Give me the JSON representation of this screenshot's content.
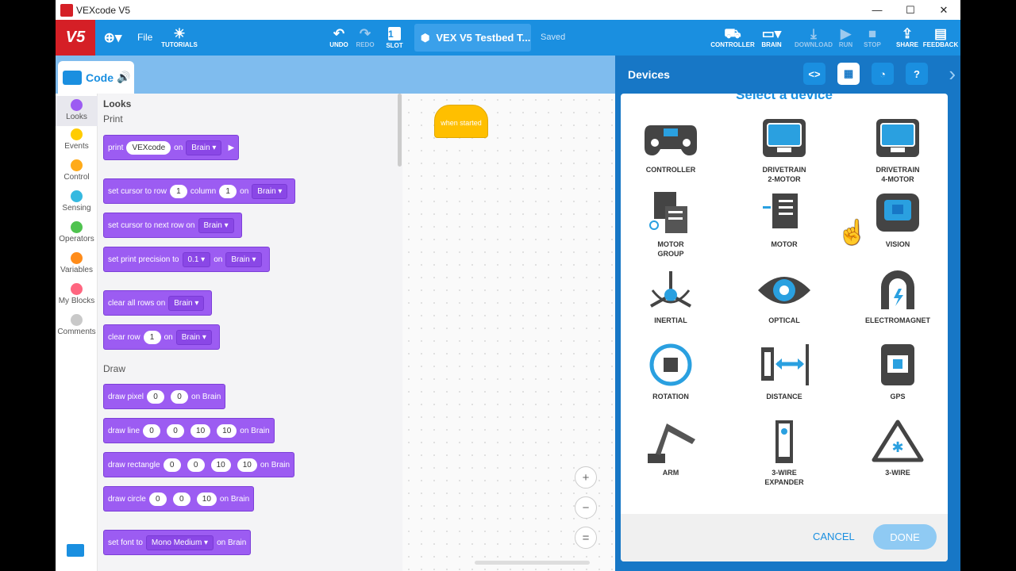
{
  "window": {
    "title": "VEXcode V5",
    "min": "—",
    "max": "☐",
    "close": "✕"
  },
  "topbar": {
    "logo": "V5",
    "file": "File",
    "tutorials": "TUTORIALS",
    "undo": "UNDO",
    "redo": "REDO",
    "slot": "SLOT",
    "slot_num": "1",
    "project_name": "VEX V5 Testbed T...",
    "status": "Saved",
    "controller": "CONTROLLER",
    "brain": "BRAIN",
    "download": "DOWNLOAD",
    "run": "RUN",
    "stop": "STOP",
    "share": "SHARE",
    "feedback": "FEEDBACK"
  },
  "codetab": {
    "label": "Code"
  },
  "categories": [
    {
      "label": "Looks",
      "color": "#9c5cf2"
    },
    {
      "label": "Events",
      "color": "#ffcc00"
    },
    {
      "label": "Control",
      "color": "#ffab19"
    },
    {
      "label": "Sensing",
      "color": "#36b9e0"
    },
    {
      "label": "Operators",
      "color": "#4fc34f"
    },
    {
      "label": "Variables",
      "color": "#ff8c1a"
    },
    {
      "label": "My Blocks",
      "color": "#ff6680"
    },
    {
      "label": "Comments",
      "color": "#c9c9c9"
    }
  ],
  "palette": {
    "section": "Looks",
    "print_heading": "Print",
    "draw_heading": "Draw",
    "print": {
      "a": "print",
      "val": "VEXcode",
      "on": "on",
      "dev": "Brain",
      "play": "▶"
    },
    "set_cursor": {
      "a": "set cursor to row",
      "row": "1",
      "col_lbl": "column",
      "col": "1",
      "on": "on",
      "dev": "Brain"
    },
    "next_row": {
      "a": "set cursor to next row on",
      "dev": "Brain"
    },
    "precision": {
      "a": "set print precision to",
      "val": "0.1",
      "on": "on",
      "dev": "Brain"
    },
    "clear_all": {
      "a": "clear all rows on",
      "dev": "Brain"
    },
    "clear_row": {
      "a": "clear row",
      "val": "1",
      "on": "on",
      "dev": "Brain"
    },
    "pixel": {
      "a": "draw pixel",
      "x": "0",
      "y": "0",
      "on": "on Brain"
    },
    "line": {
      "a": "draw line",
      "v1": "0",
      "v2": "0",
      "v3": "10",
      "v4": "10",
      "on": "on Brain"
    },
    "rect": {
      "a": "draw rectangle",
      "v1": "0",
      "v2": "0",
      "v3": "10",
      "v4": "10",
      "on": "on Brain"
    },
    "circle": {
      "a": "draw circle",
      "v1": "0",
      "v2": "0",
      "v3": "10",
      "on": "on Brain"
    },
    "font": {
      "a": "set font to",
      "val": "Mono Medium",
      "on": "on Brain"
    }
  },
  "workspace": {
    "hat": "when started",
    "zoom_in": "+",
    "zoom_out": "−",
    "reset": "="
  },
  "devices_panel": {
    "title": "Devices",
    "dialog_title": "Select a device",
    "cancel": "CANCEL",
    "done": "DONE",
    "devices": [
      {
        "name": "CONTROLLER",
        "sub": ""
      },
      {
        "name": "DRIVETRAIN",
        "sub": "2-MOTOR"
      },
      {
        "name": "DRIVETRAIN",
        "sub": "4-MOTOR"
      },
      {
        "name": "MOTOR",
        "sub": "GROUP"
      },
      {
        "name": "MOTOR",
        "sub": ""
      },
      {
        "name": "VISION",
        "sub": ""
      },
      {
        "name": "INERTIAL",
        "sub": ""
      },
      {
        "name": "OPTICAL",
        "sub": ""
      },
      {
        "name": "ELECTROMAGNET",
        "sub": ""
      },
      {
        "name": "ROTATION",
        "sub": ""
      },
      {
        "name": "DISTANCE",
        "sub": ""
      },
      {
        "name": "GPS",
        "sub": ""
      },
      {
        "name": "ARM",
        "sub": ""
      },
      {
        "name": "3-WIRE",
        "sub": "EXPANDER"
      },
      {
        "name": "3-WIRE",
        "sub": ""
      }
    ]
  },
  "colors": {
    "accent": "#1a8fe0",
    "brand": "#d51f26",
    "looks": "#9c5cf2",
    "event": "#ffbf00"
  }
}
